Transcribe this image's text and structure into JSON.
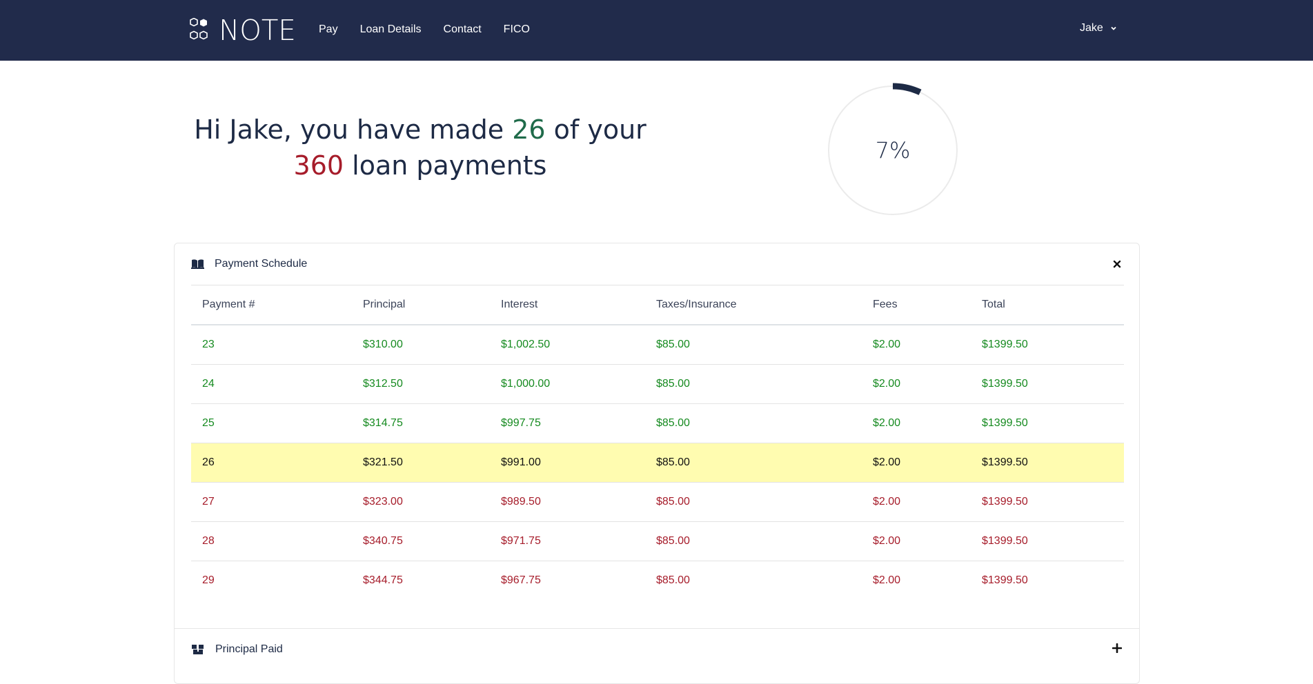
{
  "brand": {
    "name": "NOTE",
    "logo_icon": "hexagon-cluster-icon"
  },
  "nav": {
    "links": [
      "Pay",
      "Loan Details",
      "Contact",
      "FICO"
    ],
    "user": "Jake"
  },
  "hero": {
    "greeting_prefix": "Hi Jake, you have made",
    "payments_made": "26",
    "greeting_middle": "of your",
    "payments_total": "360",
    "greeting_suffix": "loan payments",
    "progress_percent": 7,
    "progress_label": "7%"
  },
  "schedule": {
    "title": "Payment Schedule",
    "header_icon": "open-book-icon",
    "close_icon": "close-icon",
    "columns": [
      "Payment #",
      "Principal",
      "Interest",
      "Taxes/Insurance",
      "Fees",
      "Total"
    ],
    "rows": [
      {
        "status": "past",
        "cells": [
          "23",
          "$310.00",
          "$1,002.50",
          "$85.00",
          "$2.00",
          "$1399.50"
        ]
      },
      {
        "status": "past",
        "cells": [
          "24",
          "$312.50",
          "$1,000.00",
          "$85.00",
          "$2.00",
          "$1399.50"
        ]
      },
      {
        "status": "past",
        "cells": [
          "25",
          "$314.75",
          "$997.75",
          "$85.00",
          "$2.00",
          "$1399.50"
        ]
      },
      {
        "status": "current",
        "cells": [
          "26",
          "$321.50",
          "$991.00",
          "$85.00",
          "$2.00",
          "$1399.50"
        ]
      },
      {
        "status": "future",
        "cells": [
          "27",
          "$323.00",
          "$989.50",
          "$85.00",
          "$2.00",
          "$1399.50"
        ]
      },
      {
        "status": "future",
        "cells": [
          "28",
          "$340.75",
          "$971.75",
          "$85.00",
          "$2.00",
          "$1399.50"
        ]
      },
      {
        "status": "future",
        "cells": [
          "29",
          "$344.75",
          "$967.75",
          "$85.00",
          "$2.00",
          "$1399.50"
        ]
      }
    ]
  },
  "principal_paid": {
    "title": "Principal Paid",
    "header_icon": "boxes-icon",
    "expand_icon": "plus-icon"
  },
  "colors": {
    "navbar": "#212b4b",
    "made": "#1f6b4a",
    "total": "#a61c2a",
    "past_row": "#158a1f",
    "future_row": "#a61c2a",
    "current_row_bg": "#fffcb0"
  }
}
